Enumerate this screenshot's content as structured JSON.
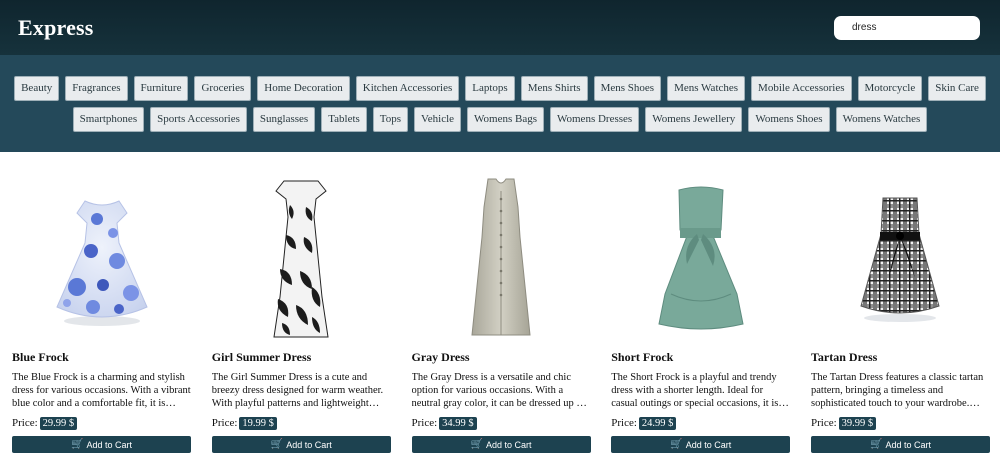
{
  "header": {
    "brand": "Express",
    "search_value": "dress"
  },
  "categories": {
    "row1": [
      "Beauty",
      "Fragrances",
      "Furniture",
      "Groceries",
      "Home Decoration",
      "Kitchen Accessories",
      "Laptops",
      "Mens Shirts",
      "Mens Shoes",
      "Mens Watches",
      "Mobile Accessories",
      "Motorcycle",
      "Skin Care"
    ],
    "row2": [
      "Smartphones",
      "Sports Accessories",
      "Sunglasses",
      "Tablets",
      "Tops",
      "Vehicle",
      "Womens Bags",
      "Womens Dresses",
      "Womens Jewellery",
      "Womens Shoes",
      "Womens Watches"
    ]
  },
  "products": [
    {
      "name": "Blue Frock",
      "desc": "The Blue Frock is a charming and stylish dress for various occasions. With a vibrant blue color and a comfortable fit, it is perfect.",
      "price_label": "Price:",
      "price": "29.99 $",
      "cart": "Add to Cart",
      "image_icon": "blue-frock-image"
    },
    {
      "name": "Girl Summer Dress",
      "desc": "The Girl Summer Dress is a cute and breezy dress designed for warm weather. With playful patterns and lightweight fabric, it is ideal.",
      "price_label": "Price:",
      "price": "19.99 $",
      "cart": "Add to Cart",
      "image_icon": "summer-dress-image"
    },
    {
      "name": "Gray Dress",
      "desc": "The Gray Dress is a versatile and chic option for various occasions. With a neutral gray color, it can be dressed up or down.",
      "price_label": "Price:",
      "price": "34.99 $",
      "cart": "Add to Cart",
      "image_icon": "gray-dress-image"
    },
    {
      "name": "Short Frock",
      "desc": "The Short Frock is a playful and trendy dress with a shorter length. Ideal for casual outings or special occasions, it is fun.",
      "price_label": "Price:",
      "price": "24.99 $",
      "cart": "Add to Cart",
      "image_icon": "short-frock-image"
    },
    {
      "name": "Tartan Dress",
      "desc": "The Tartan Dress features a classic tartan pattern, bringing a timeless and sophisticated touch to your wardrobe. Perfect style.",
      "price_label": "Price:",
      "price": "39.99 $",
      "cart": "Add to Cart",
      "image_icon": "tartan-dress-image"
    }
  ]
}
